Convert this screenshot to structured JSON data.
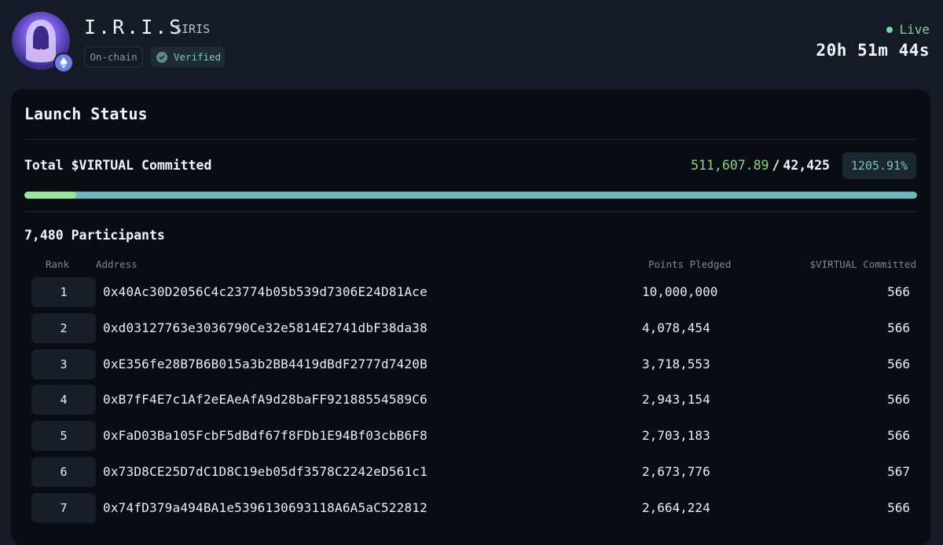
{
  "token": {
    "name": "I.R.I.S",
    "ticker": "$IRIS",
    "badges": {
      "onchain": "On-chain",
      "verified": "Verified"
    },
    "avatar_icon": "hooded-figure-avatar",
    "chain_icon": "ethereum-icon"
  },
  "status": {
    "live_label": "Live",
    "countdown": "20h 51m 44s",
    "live_color": "#7fd39a"
  },
  "launch": {
    "title": "Launch Status",
    "commit_label": "Total $VIRTUAL Committed",
    "committed": "511,607.89",
    "separator": "/",
    "target": "42,425",
    "percent": "1205.91%",
    "progress_fraction": 0.058,
    "participants": "7,480 Participants"
  },
  "table": {
    "headers": {
      "rank": "Rank",
      "address": "Address",
      "points": "Points Pledged",
      "virtual": "$VIRTUAL Committed"
    },
    "rows": [
      {
        "rank": "1",
        "address": "0x40Ac30D2056C4c23774b05b539d7306E24D81Ace",
        "points": "10,000,000",
        "virtual": "566"
      },
      {
        "rank": "2",
        "address": "0xd03127763e3036790Ce32e5814E2741dbF38da38",
        "points": "4,078,454",
        "virtual": "566"
      },
      {
        "rank": "3",
        "address": "0xE356fe28B7B6B015a3b2BB4419dBdF2777d7420B",
        "points": "3,718,553",
        "virtual": "566"
      },
      {
        "rank": "4",
        "address": "0xB7fF4E7c1Af2eEAeAfA9d28baFF92188554589C6",
        "points": "2,943,154",
        "virtual": "566"
      },
      {
        "rank": "5",
        "address": "0xFaD03Ba105FcbF5dBdf67f8FDb1E94Bf03cbB6F8",
        "points": "2,703,183",
        "virtual": "566"
      },
      {
        "rank": "6",
        "address": "0x73D8CE25D7dC1D8C19eb05df3578C2242eD561c1",
        "points": "2,673,776",
        "virtual": "567"
      },
      {
        "rank": "7",
        "address": "0x74fD379a494BA1e5396130693118A6A5aC522812",
        "points": "2,664,224",
        "virtual": "566"
      }
    ]
  }
}
